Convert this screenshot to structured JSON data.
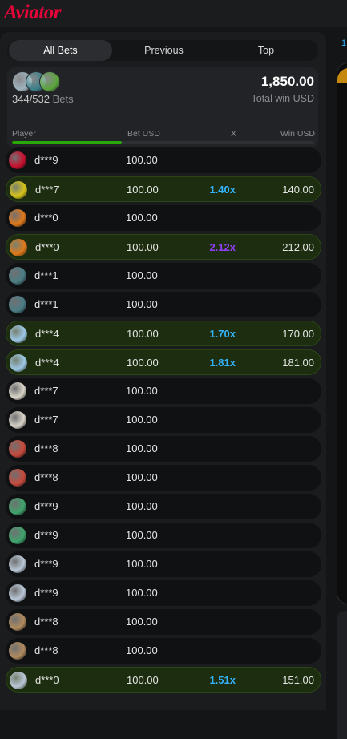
{
  "app": {
    "logo_text": "Aviator"
  },
  "tabs": [
    {
      "label": "All Bets",
      "active": true
    },
    {
      "label": "Previous",
      "active": false
    },
    {
      "label": "Top",
      "active": false
    }
  ],
  "summary": {
    "bets_count": "344/532",
    "bets_label": "Bets",
    "total_win": "1,850.00",
    "total_win_label": "Total win USD",
    "progress_fraction": 0.3626,
    "avatar_colors": [
      "#9fb4c0",
      "#3a7f8a",
      "#59a53a"
    ]
  },
  "columns": {
    "player": "Player",
    "bet": "Bet USD",
    "x": "X",
    "win": "Win USD"
  },
  "right_panel": {
    "tab_fragment": "1"
  },
  "colors": {
    "accent_red": "#e50539",
    "win_green": "#28a909",
    "mult_blue": "#34b4ff",
    "mult_purple": "#913ef8"
  },
  "rows": [
    {
      "player": "d***9",
      "bet": "100.00",
      "mult": "",
      "win": "",
      "won": false,
      "avatar": "dice-avatar",
      "av_color": "#c8102e",
      "mult_color": ""
    },
    {
      "player": "d***7",
      "bet": "100.00",
      "mult": "1.40x",
      "win": "140.00",
      "won": true,
      "avatar": "triangle-avatar",
      "av_color": "#d6c31a",
      "mult_color": "blue"
    },
    {
      "player": "d***0",
      "bet": "100.00",
      "mult": "",
      "win": "",
      "won": false,
      "avatar": "basketball-avatar",
      "av_color": "#e0781b",
      "mult_color": ""
    },
    {
      "player": "d***0",
      "bet": "100.00",
      "mult": "2.12x",
      "win": "212.00",
      "won": true,
      "avatar": "basketball-avatar",
      "av_color": "#e0781b",
      "mult_color": "purple"
    },
    {
      "player": "d***1",
      "bet": "100.00",
      "mult": "",
      "win": "",
      "won": false,
      "avatar": "helmet-avatar",
      "av_color": "#4b7d85",
      "mult_color": ""
    },
    {
      "player": "d***1",
      "bet": "100.00",
      "mult": "",
      "win": "",
      "won": false,
      "avatar": "helmet-avatar",
      "av_color": "#4b7d85",
      "mult_color": ""
    },
    {
      "player": "d***4",
      "bet": "100.00",
      "mult": "1.70x",
      "win": "170.00",
      "won": true,
      "avatar": "rocket-avatar",
      "av_color": "#9cc7e6",
      "mult_color": "blue"
    },
    {
      "player": "d***4",
      "bet": "100.00",
      "mult": "1.81x",
      "win": "181.00",
      "won": true,
      "avatar": "rocket-avatar",
      "av_color": "#9cc7e6",
      "mult_color": "blue"
    },
    {
      "player": "d***7",
      "bet": "100.00",
      "mult": "",
      "win": "",
      "won": false,
      "avatar": "eagle-avatar",
      "av_color": "#d9d4c8",
      "mult_color": ""
    },
    {
      "player": "d***7",
      "bet": "100.00",
      "mult": "",
      "win": "",
      "won": false,
      "avatar": "eagle-avatar",
      "av_color": "#d9d4c8",
      "mult_color": ""
    },
    {
      "player": "d***8",
      "bet": "100.00",
      "mult": "",
      "win": "",
      "won": false,
      "avatar": "character-avatar",
      "av_color": "#c74a3c",
      "mult_color": ""
    },
    {
      "player": "d***8",
      "bet": "100.00",
      "mult": "",
      "win": "",
      "won": false,
      "avatar": "character-avatar",
      "av_color": "#c74a3c",
      "mult_color": ""
    },
    {
      "player": "d***9",
      "bet": "100.00",
      "mult": "",
      "win": "",
      "won": false,
      "avatar": "bird-avatar",
      "av_color": "#3fa36c",
      "mult_color": ""
    },
    {
      "player": "d***9",
      "bet": "100.00",
      "mult": "",
      "win": "",
      "won": false,
      "avatar": "bird-avatar",
      "av_color": "#3fa36c",
      "mult_color": ""
    },
    {
      "player": "d***9",
      "bet": "100.00",
      "mult": "",
      "win": "",
      "won": false,
      "avatar": "gear-avatar",
      "av_color": "#b9c7d6",
      "mult_color": ""
    },
    {
      "player": "d***9",
      "bet": "100.00",
      "mult": "",
      "win": "",
      "won": false,
      "avatar": "gear-avatar",
      "av_color": "#b9c7d6",
      "mult_color": ""
    },
    {
      "player": "d***8",
      "bet": "100.00",
      "mult": "",
      "win": "",
      "won": false,
      "avatar": "lion-avatar",
      "av_color": "#b08b5e",
      "mult_color": ""
    },
    {
      "player": "d***8",
      "bet": "100.00",
      "mult": "",
      "win": "",
      "won": false,
      "avatar": "lion-avatar",
      "av_color": "#b08b5e",
      "mult_color": ""
    },
    {
      "player": "d***0",
      "bet": "100.00",
      "mult": "1.51x",
      "win": "151.00",
      "won": true,
      "avatar": "gear-avatar",
      "av_color": "#b9c7d6",
      "mult_color": "blue"
    }
  ]
}
